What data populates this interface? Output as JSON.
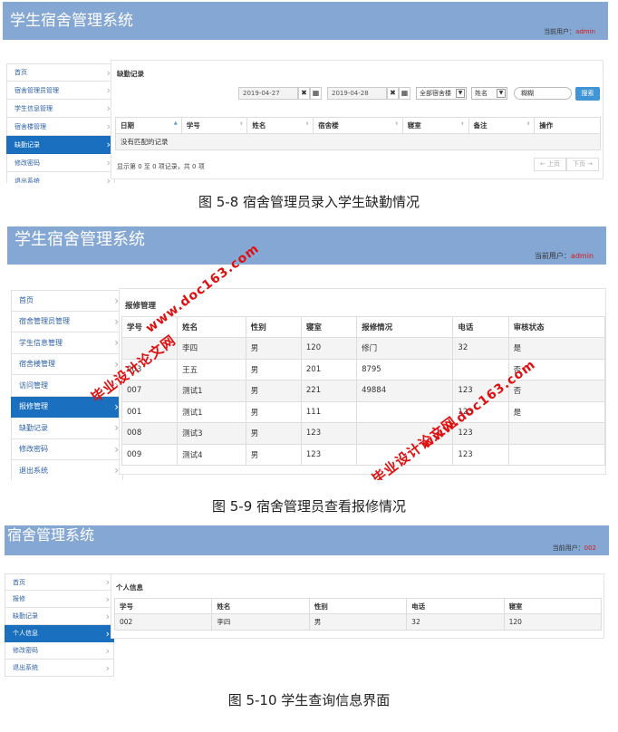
{
  "app_title": "学生宿舍管理系统",
  "app_title_short": "宿舍管理系统",
  "user_label": "当前用户：",
  "fig1": {
    "user": "admin",
    "sidebar": [
      "首页",
      "宿舍管理员管理",
      "学生信息管理",
      "宿舍楼管理",
      "缺勤记录",
      "修改密码",
      "退出系统"
    ],
    "active_index": 4,
    "panel_title": "缺勤记录",
    "date_from": "2019-04-27",
    "date_to": "2019-04-28",
    "building_select": "全部宿舍楼",
    "field_select": "姓名",
    "search_value": "糊糊",
    "search_button": "搜索",
    "columns": [
      "日期",
      "学号",
      "姓名",
      "宿舍楼",
      "寝室",
      "备注",
      "操作"
    ],
    "empty_text": "没有匹配的记录",
    "summary": "显示第 0 至 0 项记录，共 0 项",
    "prev": "← 上页",
    "next": "下页 →",
    "caption": "图 5-8   宿舍管理员录入学生缺勤情况"
  },
  "fig2": {
    "user": "admin",
    "sidebar": [
      "首页",
      "宿舍管理员管理",
      "学生信息管理",
      "宿舍楼管理",
      "访问管理",
      "报修管理",
      "缺勤记录",
      "修改密码",
      "退出系统"
    ],
    "active_index": 5,
    "panel_title": "报修管理",
    "columns": [
      "学号",
      "姓名",
      "性别",
      "寝室",
      "报修情况",
      "电话",
      "审核状态"
    ],
    "rows": [
      [
        "",
        "李四",
        "男",
        "120",
        "修门",
        "32",
        "是"
      ],
      [
        "003",
        "王五",
        "男",
        "201",
        "8795",
        "",
        "否"
      ],
      [
        "007",
        "测试1",
        "男",
        "221",
        "49884",
        "123",
        "否"
      ],
      [
        "001",
        "测试1",
        "男",
        "111",
        "",
        "123",
        "是"
      ],
      [
        "008",
        "测试3",
        "男",
        "123",
        "",
        "123",
        ""
      ],
      [
        "009",
        "测试4",
        "男",
        "123",
        "",
        "123",
        ""
      ]
    ],
    "watermark_url": "www.doc163.com",
    "watermark_cn": "毕业设计论文网",
    "caption": "图 5-9   宿舍管理员查看报修情况"
  },
  "fig3": {
    "user": "002",
    "sidebar": [
      "首页",
      "报修",
      "缺勤记录",
      "个人信息",
      "修改密码",
      "退出系统"
    ],
    "active_index": 3,
    "panel_title": "个人信息",
    "columns": [
      "学号",
      "姓名",
      "性别",
      "电话",
      "寝室"
    ],
    "row": [
      "002",
      "李四",
      "男",
      "32",
      "120"
    ],
    "caption": "图 5-10   学生查询信息界面"
  },
  "colors": {
    "header": "#85a7d4",
    "active": "#1a6fbe",
    "watermark": "#e01010",
    "username": "#d71a1a"
  }
}
